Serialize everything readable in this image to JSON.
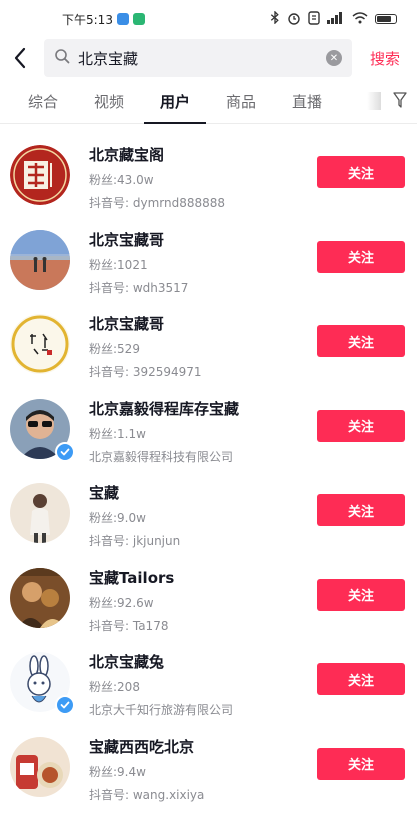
{
  "status_bar": {
    "time": "下午5:13",
    "app_icon_colors": [
      "#3a8ee6",
      "#2bb673"
    ],
    "battery_level": 0.7
  },
  "search": {
    "query": "北京宝藏",
    "submit_label": "搜索"
  },
  "tabs": [
    {
      "label": "综合",
      "active": false
    },
    {
      "label": "视频",
      "active": false
    },
    {
      "label": "用户",
      "active": true
    },
    {
      "label": "商品",
      "active": false
    },
    {
      "label": "直播",
      "active": false
    }
  ],
  "colors": {
    "accent": "#fe2c55",
    "verified": "#3d9bf5"
  },
  "users": [
    {
      "name": "北京藏宝阁",
      "followers": "粉丝:43.0w",
      "account": "抖音号: dymrnd888888",
      "follow_label": "关注",
      "verified": false,
      "avatar": "logo-red-circle"
    },
    {
      "name": "北京宝藏哥",
      "followers": "粉丝:1021",
      "account": "抖音号: wdh3517",
      "follow_label": "关注",
      "verified": false,
      "avatar": "landscape-photo"
    },
    {
      "name": "北京宝藏哥",
      "followers": "粉丝:529",
      "account": "抖音号: 392594971",
      "follow_label": "关注",
      "verified": false,
      "avatar": "calligraphy-seal"
    },
    {
      "name": "北京嘉毅得程库存宝藏",
      "followers": "粉丝:1.1w",
      "account": "北京嘉毅得程科技有限公司",
      "follow_label": "关注",
      "verified": true,
      "avatar": "person-sunglasses"
    },
    {
      "name": "宝藏",
      "followers": "粉丝:9.0w",
      "account": "抖音号: jkjunjun",
      "follow_label": "关注",
      "verified": false,
      "avatar": "person-photo"
    },
    {
      "name": "宝藏Tailors",
      "followers": "粉丝:92.6w",
      "account": "抖音号: Ta178",
      "follow_label": "关注",
      "verified": false,
      "avatar": "painting-photo"
    },
    {
      "name": "北京宝藏兔",
      "followers": "粉丝:208",
      "account": "北京大千知行旅游有限公司",
      "follow_label": "关注",
      "verified": true,
      "avatar": "rabbit-cartoon"
    },
    {
      "name": "宝藏西西吃北京",
      "followers": "粉丝:9.4w",
      "account": "抖音号: wang.xixiya",
      "follow_label": "关注",
      "verified": false,
      "avatar": "food-photo"
    }
  ]
}
